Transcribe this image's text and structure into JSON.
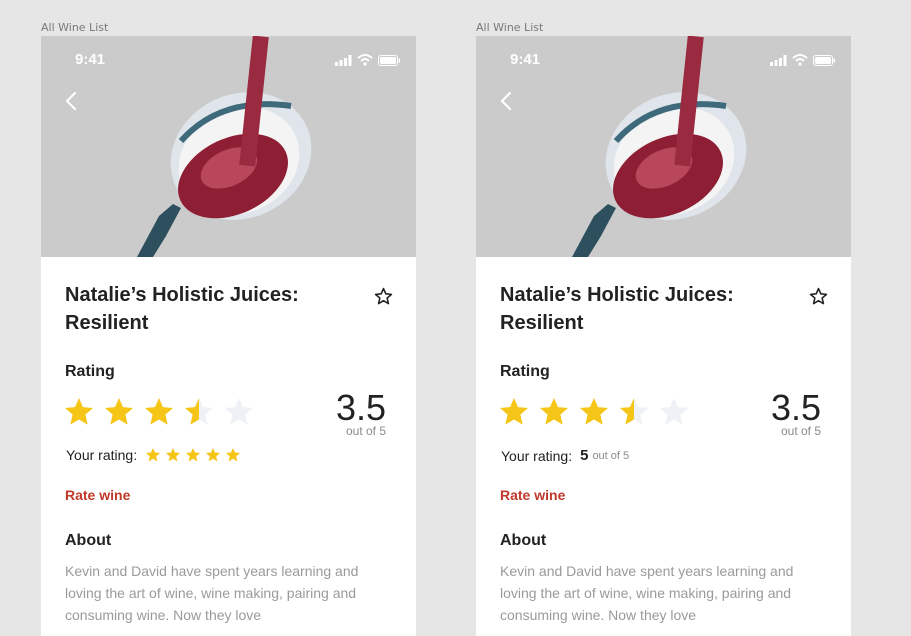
{
  "colors": {
    "accent": "#c0392b",
    "star_filled": "#f5c518",
    "star_empty": "#eef1f5",
    "hero_bg": "#cbcbcb",
    "wine": "#8e1e33"
  },
  "screens": [
    {
      "frame_label": "All Wine List",
      "status": {
        "time": "9:41",
        "icons": [
          "signal-icon",
          "wifi-icon",
          "battery-icon"
        ]
      },
      "back_icon": "chevron-left-icon",
      "favorite_icon": "star-outline-icon",
      "title": "Natalie’s Holistic Juices: Resilient",
      "rating_label": "Rating",
      "rating": {
        "value": "3.5",
        "out_of": "out of 5",
        "stars": 3.5,
        "max": 5
      },
      "your_rating": {
        "label": "Your rating:",
        "display": "stars",
        "stars": 5
      },
      "rate_link": "Rate wine",
      "about_label": "About",
      "about_text": "Kevin and David have spent years learning and loving the art of wine, wine making, pairing and consuming wine.  Now they love"
    },
    {
      "frame_label": "All Wine List",
      "status": {
        "time": "9:41",
        "icons": [
          "signal-icon",
          "wifi-icon",
          "battery-icon"
        ]
      },
      "back_icon": "chevron-left-icon",
      "favorite_icon": "star-outline-icon",
      "title": "Natalie’s Holistic Juices: Resilient",
      "rating_label": "Rating",
      "rating": {
        "value": "3.5",
        "out_of": "out of 5",
        "stars": 3.5,
        "max": 5
      },
      "your_rating": {
        "label": "Your rating:",
        "display": "number",
        "value": "5",
        "out_of": "out of 5"
      },
      "rate_link": "Rate wine",
      "about_label": "About",
      "about_text": "Kevin and David have spent years learning and loving the art of wine, wine making, pairing and consuming wine.  Now they love"
    }
  ]
}
